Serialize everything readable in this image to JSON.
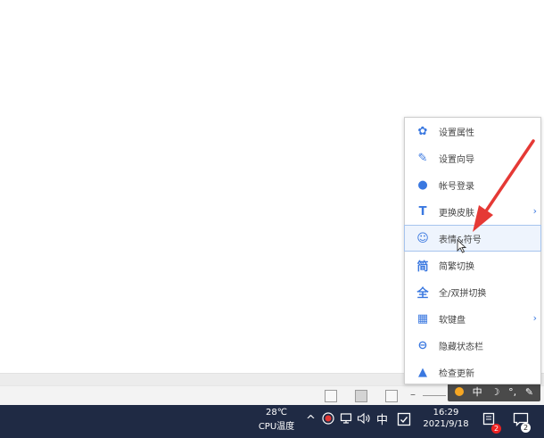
{
  "context_menu": {
    "items": [
      {
        "label": "设置属性",
        "icon": "gear-icon",
        "glyph": "✿"
      },
      {
        "label": "设置向导",
        "icon": "brush-icon",
        "glyph": "✎"
      },
      {
        "label": "帐号登录",
        "icon": "user-icon",
        "glyph": "●"
      },
      {
        "label": "更换皮肤",
        "icon": "shirt-icon",
        "glyph": "T"
      },
      {
        "label": "表情&符号",
        "icon": "smiley-icon",
        "glyph": "☺"
      },
      {
        "label": "简繁切换",
        "icon": "jian-icon",
        "glyph": "简"
      },
      {
        "label": "全/双拼切换",
        "icon": "quan-icon",
        "glyph": "全"
      },
      {
        "label": "软键盘",
        "icon": "keyboard-icon",
        "glyph": "▦"
      },
      {
        "label": "隐藏状态栏",
        "icon": "minus-circle-icon",
        "glyph": "⊖"
      },
      {
        "label": "检查更新",
        "icon": "up-arrow-icon",
        "glyph": "▲"
      }
    ]
  },
  "ime_toolbar": {
    "mode": "中",
    "moon": "☽",
    "dots": "°,",
    "wrench": "✎"
  },
  "taskbar": {
    "temperature": "28℃",
    "temperature_label": "CPU温度",
    "tray_chevron": "^",
    "input_mode": "中",
    "time": "16:29",
    "date": "2021/9/18",
    "badge_count_1": "2",
    "badge_count_2": "2"
  },
  "colors": {
    "accent": "#3a78e0",
    "taskbar": "#1f2a44",
    "arrow": "#e53935"
  }
}
